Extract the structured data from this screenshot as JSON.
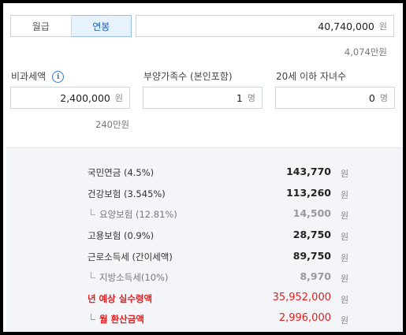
{
  "tabs": [
    {
      "label": "월급",
      "active": false
    },
    {
      "label": "연봉",
      "active": true
    }
  ],
  "salary": {
    "value": "40,740,000",
    "unit": "원",
    "sub": "4,074만원"
  },
  "nontax": {
    "label": "비과세액",
    "value": "2,400,000",
    "unit": "원",
    "sub": "240만원"
  },
  "dependents": {
    "label": "부양가족수 (본인포함)",
    "value": "1",
    "unit": "명"
  },
  "children": {
    "label": "20세 이하 자녀수",
    "value": "0",
    "unit": "명"
  },
  "results": [
    {
      "label": "국민연금 (4.5%)",
      "value": "143,770",
      "unit": "원"
    },
    {
      "label": "건강보험 (3.545%)",
      "value": "113,260",
      "unit": "원"
    },
    {
      "label": "요양보험 (12.81%)",
      "value": "14,500",
      "unit": "원"
    },
    {
      "label": "고용보험 (0.9%)",
      "value": "28,750",
      "unit": "원"
    },
    {
      "label": "근로소득세 (간이세액)",
      "value": "89,750",
      "unit": "원"
    },
    {
      "label": "지방소득세(10%)",
      "value": "8,970",
      "unit": "원"
    },
    {
      "label": "년 예상 실수령액",
      "value": "35,952,000",
      "unit": "원"
    },
    {
      "label": "월 환산금액",
      "value": "2,996,000",
      "unit": "원"
    }
  ]
}
